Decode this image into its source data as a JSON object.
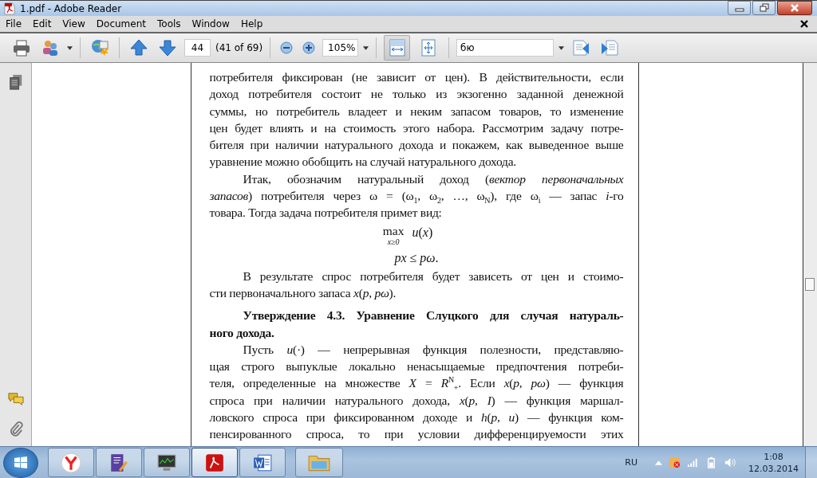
{
  "window": {
    "title": "1.pdf - Adobe Reader"
  },
  "menu": [
    "File",
    "Edit",
    "View",
    "Document",
    "Tools",
    "Window",
    "Help"
  ],
  "toolbar": {
    "page_number": "44",
    "page_count": "(41 of 69)",
    "zoom": "105%",
    "search": "бю",
    "view_modes": [
      {
        "kind": "fit-width",
        "selected": true
      },
      {
        "kind": "fit-page",
        "selected": false
      }
    ]
  },
  "document": {
    "blocks": [
      {
        "kind": "continued",
        "lines": [
          "потребителя фиксирован (не зависит от цен). В действительности, если",
          "доход потребителя состоит не только из экзогенно заданной денежной",
          "суммы, но потребитель владеет и неким запасом товаров, то изменение",
          "цен будет влиять и на стоимость этого набора. Рассмотрим задачу потре-",
          "бителя при наличии натурального дохода и покажем, как выведенное выше",
          "уравнение можно обобщить на случай натурального дохода."
        ]
      },
      {
        "kind": "paragraph",
        "lines": [
          "Итак, обозначим натуральный доход (*вектор первоначальных*",
          "*запасов*) потребителя через ω = (ω$_{1}$, ω$_{2}$, …, ω$_{N}$), где ω$_{i}$ — запас *i*-го",
          "товара. Тогда задача потребителя примет вид:"
        ]
      },
      {
        "kind": "formula",
        "operator": "max",
        "operator_sub": "x≥0",
        "objective": "*u*(*x*)",
        "constraint": "*px* ≤ *pω*."
      },
      {
        "kind": "paragraph",
        "lines": [
          "В результате спрос потребителя будет зависеть от цен и стоимо-",
          "сти первоначального запаса *x*(*p*, *pω*)."
        ]
      },
      {
        "kind": "heading",
        "lines": [
          "Утверждение 4.3. Уравнение Слуцкого для случая натураль-",
          "ного дохода."
        ]
      },
      {
        "kind": "paragraph",
        "continues": true,
        "lines": [
          "Пусть *u*(·) — непрерывная функция полезности, представляю-",
          "щая строго выпуклые локально ненасыщаемые предпочтения потреби-",
          "теля, определенные на множестве *X* = *R*$^{N}$$_{+}$. Если *x*(*p*, *pω*) — функция",
          "спроса при наличии натурального дохода, *x*(*p*, *I*) — функция маршал-",
          "ловского спроса при фиксированном доходе и *h*(*p*, *u*) — функция ком-",
          "пенсированного спроса, то при условии дифференцируемости этих"
        ]
      }
    ]
  },
  "taskbar": {
    "apps": [
      {
        "kind": "browser",
        "selected": false
      },
      {
        "kind": "editor",
        "selected": false
      },
      {
        "kind": "monitor",
        "selected": false
      },
      {
        "kind": "pdf",
        "selected": true
      },
      {
        "kind": "word",
        "selected": false
      },
      {
        "kind": "folder",
        "selected": false
      }
    ],
    "language": "RU",
    "time": "1:08",
    "date": "12.03.2014"
  }
}
